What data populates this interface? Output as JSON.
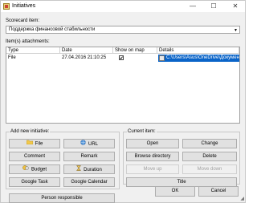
{
  "window": {
    "title": "Initiatives",
    "minimize_glyph": "—",
    "maximize_glyph": "☐",
    "close_glyph": "✕"
  },
  "scorecard": {
    "label": "Scorecard item:",
    "value": "Поддержка финансовой стабильности"
  },
  "attachments": {
    "label": "Item(s) attachments:",
    "columns": [
      "Type",
      "Date",
      "Show on map",
      "Details"
    ],
    "rows": [
      {
        "type": "File",
        "date": "27.04.2016 21:10:25",
        "show_on_map": true,
        "details": "C:\\Users\\Asus\\OneDrive\\Докумен..."
      }
    ]
  },
  "add_new": {
    "title": "Add new initiative:",
    "buttons": {
      "file": "File",
      "url": "URL",
      "comment": "Comment",
      "remark": "Remark",
      "budget": "Budget",
      "duration": "Duration",
      "google_task": "Google Task",
      "google_calendar": "Google Calendar"
    }
  },
  "person_responsible": "Person responsible",
  "current_item": {
    "title": "Current item:",
    "buttons": {
      "open": "Open",
      "change": "Change",
      "browse": "Browse directory",
      "delete": "Delete",
      "move_up": "Move up",
      "move_down": "Move down",
      "title": "Title"
    }
  },
  "footer": {
    "ok": "OK",
    "cancel": "Cancel"
  },
  "colors": {
    "selection": "#0a64c8",
    "window_bg": "#f0f0f0",
    "button_bg": "#e1e1e1"
  }
}
